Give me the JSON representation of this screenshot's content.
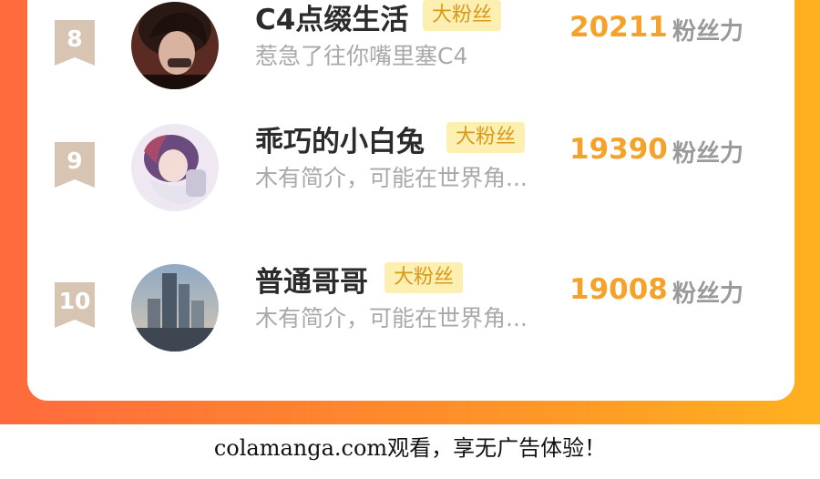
{
  "rows": [
    {
      "rank": "8",
      "name": "C4点缀生活",
      "badge": "大粉丝",
      "bio": "惹急了往你嘴里塞C4",
      "score": "20211",
      "score_label": "粉丝力",
      "avatar": "dark-haired-boy-avatar"
    },
    {
      "rank": "9",
      "name": "乖巧的小白兔",
      "badge": "大粉丝",
      "bio": "木有简介，可能在世界角...",
      "score": "19390",
      "score_label": "粉丝力",
      "avatar": "anime-girl-avatar"
    },
    {
      "rank": "10",
      "name": "普通哥哥",
      "badge": "大粉丝",
      "bio": "木有简介，可能在世界角...",
      "score": "19008",
      "score_label": "粉丝力",
      "avatar": "city-skyline-avatar"
    }
  ],
  "footer": {
    "text": "colamanga.com观看，享无广告体验！"
  },
  "colors": {
    "accent_gradient_start": "#ff6a3d",
    "accent_gradient_end": "#ffb11f",
    "score": "#f6a22a",
    "badge_bg": "#fdeeb2",
    "badge_text": "#d99a1c",
    "rank_ribbon": "#d8c4b2"
  }
}
